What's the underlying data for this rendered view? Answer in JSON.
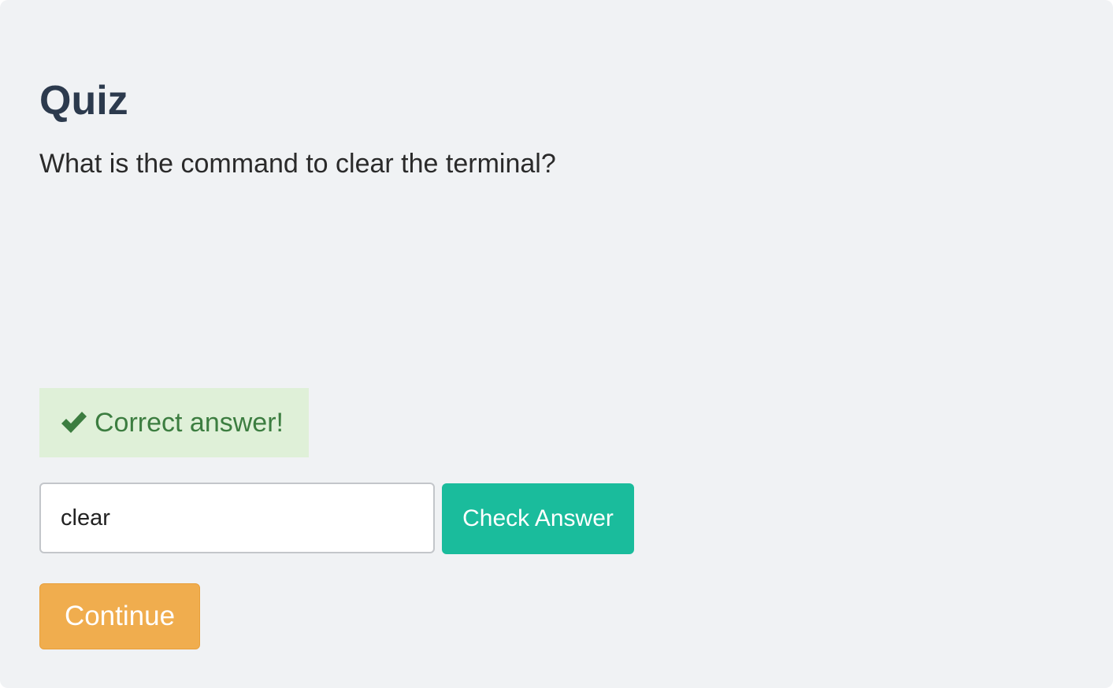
{
  "quiz": {
    "title": "Quiz",
    "question": "What is the command to clear the terminal?"
  },
  "feedback": {
    "icon": "checkmark-icon",
    "message": "Correct answer!",
    "color": "#3c7d40",
    "background": "#dff0d8"
  },
  "answer": {
    "value": "clear",
    "placeholder": ""
  },
  "buttons": {
    "check_label": "Check Answer",
    "check_color": "#1abc9c",
    "continue_label": "Continue",
    "continue_color": "#f0ad4e"
  }
}
